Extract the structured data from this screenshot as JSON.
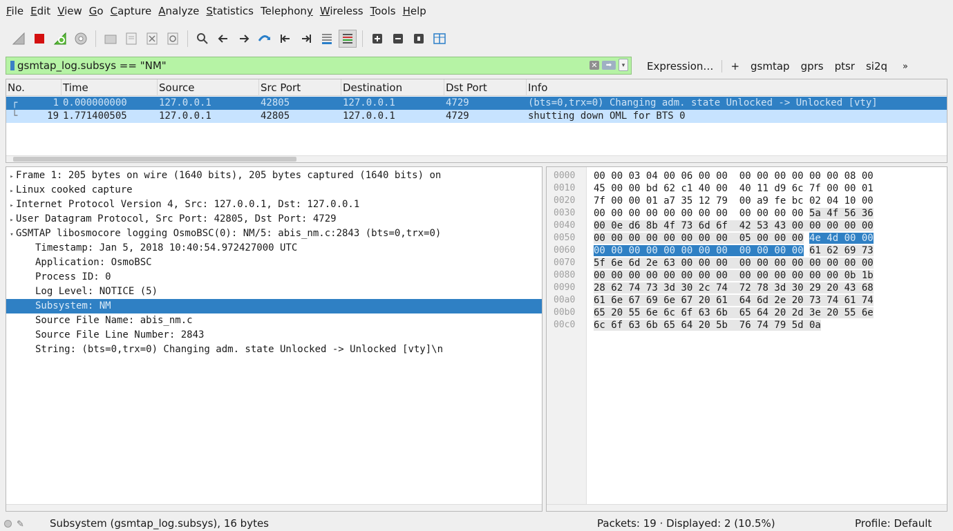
{
  "menu": [
    "File",
    "Edit",
    "View",
    "Go",
    "Capture",
    "Analyze",
    "Statistics",
    "Telephony",
    "Wireless",
    "Tools",
    "Help"
  ],
  "menu_underline": [
    "F",
    "E",
    "V",
    "G",
    "C",
    "A",
    "S",
    "y",
    "W",
    "T",
    "H"
  ],
  "filter": {
    "text": "gsmtap_log.subsys == \"NM\"",
    "expression": "Expression…",
    "plus": "+",
    "buttons": [
      "gsmtap",
      "gprs",
      "ptsr",
      "si2q"
    ],
    "more": "»"
  },
  "columns": [
    "No.",
    "Time",
    "Source",
    "Src Port",
    "Destination",
    "Dst Port",
    "Info"
  ],
  "packets": [
    {
      "no": "1",
      "time": "0.000000000",
      "source": "127.0.0.1",
      "src_port": "42805",
      "destination": "127.0.0.1",
      "dst_port": "4729",
      "info": "(bts=0,trx=0) Changing adm. state Unlocked -> Unlocked [vty]",
      "selected": true
    },
    {
      "no": "19",
      "time": "1.771400505",
      "source": "127.0.0.1",
      "src_port": "42805",
      "destination": "127.0.0.1",
      "dst_port": "4729",
      "info": "shutting down OML for BTS 0",
      "selected": false
    }
  ],
  "detail_tree": [
    {
      "text": "Frame 1: 205 bytes on wire (1640 bits), 205 bytes captured (1640 bits) on",
      "level": 0,
      "arrow": "collapsed"
    },
    {
      "text": "Linux cooked capture",
      "level": 0,
      "arrow": "collapsed"
    },
    {
      "text": "Internet Protocol Version 4, Src: 127.0.0.1, Dst: 127.0.0.1",
      "level": 0,
      "arrow": "collapsed"
    },
    {
      "text": "User Datagram Protocol, Src Port: 42805, Dst Port: 4729",
      "level": 0,
      "arrow": "collapsed"
    },
    {
      "text": "GSMTAP libosmocore logging OsmoBSC(0): NM/5: abis_nm.c:2843 (bts=0,trx=0)",
      "level": 0,
      "arrow": "expanded"
    },
    {
      "text": "Timestamp: Jan  5, 2018 10:40:54.972427000 UTC",
      "level": 1
    },
    {
      "text": "Application: OsmoBSC",
      "level": 1
    },
    {
      "text": "Process ID: 0",
      "level": 1
    },
    {
      "text": "Log Level: NOTICE (5)",
      "level": 1
    },
    {
      "text": "Subsystem: NM",
      "level": 1,
      "selected": true
    },
    {
      "text": "Source File Name: abis_nm.c",
      "level": 1
    },
    {
      "text": "Source File Line Number: 2843",
      "level": 1
    },
    {
      "text": "String: (bts=0,trx=0) Changing adm. state Unlocked -> Unlocked [vty]\\n",
      "level": 1
    }
  ],
  "bytes": [
    {
      "offset": "0000",
      "hex": [
        "00",
        "00",
        "03",
        "04",
        "00",
        "06",
        "00",
        "00",
        "00",
        "00",
        "00",
        "00",
        "00",
        "00",
        "08",
        "00"
      ],
      "ascii": ""
    },
    {
      "offset": "0010",
      "hex": [
        "45",
        "00",
        "00",
        "bd",
        "62",
        "c1",
        "40",
        "00",
        "40",
        "11",
        "d9",
        "6c",
        "7f",
        "00",
        "00",
        "01"
      ],
      "ascii": ""
    },
    {
      "offset": "0020",
      "hex": [
        "7f",
        "00",
        "00",
        "01",
        "a7",
        "35",
        "12",
        "79",
        "00",
        "a9",
        "fe",
        "bc",
        "02",
        "04",
        "10",
        "00"
      ],
      "ascii": ""
    },
    {
      "offset": "0030",
      "hex": [
        "00",
        "00",
        "00",
        "00",
        "00",
        "00",
        "00",
        "00",
        "00",
        "00",
        "00",
        "00",
        "5a",
        "4f",
        "56",
        "36"
      ],
      "ascii": ""
    },
    {
      "offset": "0040",
      "hex": [
        "00",
        "0e",
        "d6",
        "8b",
        "4f",
        "73",
        "6d",
        "6f",
        "42",
        "53",
        "43",
        "00",
        "00",
        "00",
        "00",
        "00"
      ],
      "ascii": ""
    },
    {
      "offset": "0050",
      "hex": [
        "00",
        "00",
        "00",
        "00",
        "00",
        "00",
        "00",
        "00",
        "05",
        "00",
        "00",
        "00",
        "4e",
        "4d",
        "00",
        "00"
      ],
      "ascii": ""
    },
    {
      "offset": "0060",
      "hex": [
        "00",
        "00",
        "00",
        "00",
        "00",
        "00",
        "00",
        "00",
        "00",
        "00",
        "00",
        "00",
        "61",
        "62",
        "69",
        "73"
      ],
      "ascii": ""
    },
    {
      "offset": "0070",
      "hex": [
        "5f",
        "6e",
        "6d",
        "2e",
        "63",
        "00",
        "00",
        "00",
        "00",
        "00",
        "00",
        "00",
        "00",
        "00",
        "00",
        "00"
      ],
      "ascii": ""
    },
    {
      "offset": "0080",
      "hex": [
        "00",
        "00",
        "00",
        "00",
        "00",
        "00",
        "00",
        "00",
        "00",
        "00",
        "00",
        "00",
        "00",
        "00",
        "0b",
        "1b"
      ],
      "ascii": ""
    },
    {
      "offset": "0090",
      "hex": [
        "28",
        "62",
        "74",
        "73",
        "3d",
        "30",
        "2c",
        "74",
        "72",
        "78",
        "3d",
        "30",
        "29",
        "20",
        "43",
        "68"
      ],
      "ascii": ""
    },
    {
      "offset": "00a0",
      "hex": [
        "61",
        "6e",
        "67",
        "69",
        "6e",
        "67",
        "20",
        "61",
        "64",
        "6d",
        "2e",
        "20",
        "73",
        "74",
        "61",
        "74"
      ],
      "ascii": ""
    },
    {
      "offset": "00b0",
      "hex": [
        "65",
        "20",
        "55",
        "6e",
        "6c",
        "6f",
        "63",
        "6b",
        "65",
        "64",
        "20",
        "2d",
        "3e",
        "20",
        "55",
        "6e"
      ],
      "ascii": ""
    },
    {
      "offset": "00c0",
      "hex": [
        "6c",
        "6f",
        "63",
        "6b",
        "65",
        "64",
        "20",
        "5b",
        "76",
        "74",
        "79",
        "5d",
        "0a"
      ],
      "ascii": ""
    }
  ],
  "status": {
    "field": "Subsystem (gsmtap_log.subsys), 16 bytes",
    "packets": "Packets: 19 · Displayed: 2 (10.5%)",
    "profile": "Profile: Default"
  },
  "colors": {
    "selection": "#2f80c4",
    "row_highlight": "#c7e3ff",
    "filter_ok": "#b6f3a5"
  }
}
